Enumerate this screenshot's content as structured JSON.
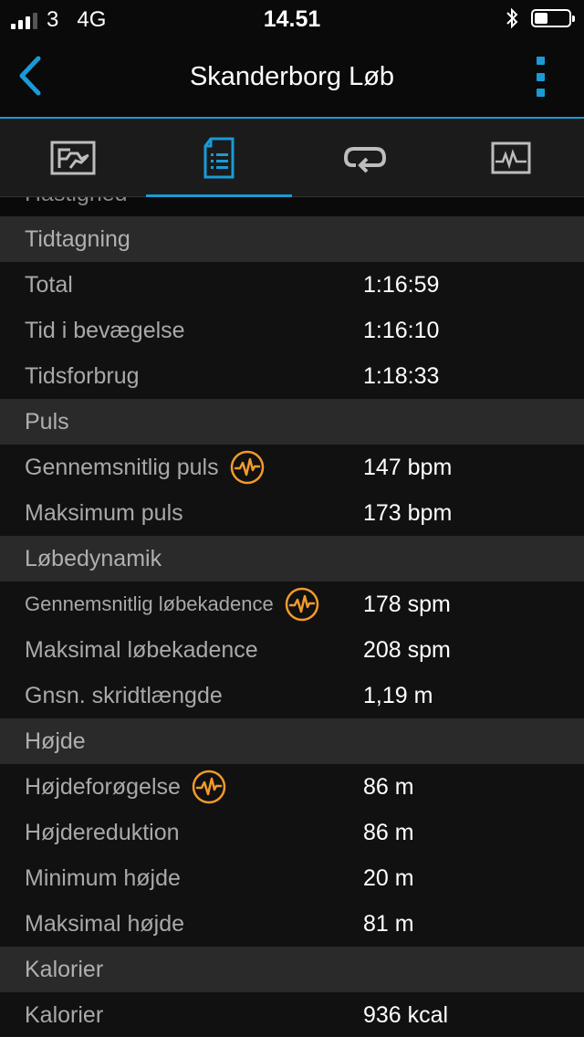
{
  "status_bar": {
    "carrier": "3",
    "network": "4G",
    "time": "14.51",
    "signal_bars": 3,
    "battery_fraction": 0.4
  },
  "nav": {
    "title": "Skanderborg Løb",
    "back_icon": "chevron-left-icon",
    "more_icon": "vertical-dots-icon"
  },
  "tabs": [
    {
      "icon": "map-icon",
      "active": false
    },
    {
      "icon": "document-list-icon",
      "active": true
    },
    {
      "icon": "laps-icon",
      "active": false
    },
    {
      "icon": "chart-icon",
      "active": false
    }
  ],
  "content": {
    "cutoff_label": "Hastighed",
    "sections": [
      {
        "title": "Tidtagning",
        "rows": [
          {
            "label": "Total",
            "value": "1:16:59"
          },
          {
            "label": "Tid i bevægelse",
            "value": "1:16:10"
          },
          {
            "label": "Tidsforbrug",
            "value": "1:18:33"
          }
        ]
      },
      {
        "title": "Puls",
        "rows": [
          {
            "label": "Gennemsnitlig puls",
            "value": "147 bpm",
            "icon": "heart-rate-icon"
          },
          {
            "label": "Maksimum puls",
            "value": "173 bpm"
          }
        ]
      },
      {
        "title": "Løbedynamik",
        "rows": [
          {
            "label": "Gennemsnitlig løbekadence",
            "value": "178 spm",
            "icon": "heart-rate-icon"
          },
          {
            "label": "Maksimal løbekadence",
            "value": "208 spm"
          },
          {
            "label": "Gnsn. skridtlængde",
            "value": "1,19 m"
          }
        ]
      },
      {
        "title": "Højde",
        "rows": [
          {
            "label": "Højdeforøgelse",
            "value": "86 m",
            "icon": "heart-rate-icon"
          },
          {
            "label": "Højdereduktion",
            "value": "86 m"
          },
          {
            "label": "Minimum højde",
            "value": "20 m"
          },
          {
            "label": "Maksimal højde",
            "value": "81 m"
          }
        ]
      },
      {
        "title": "Kalorier",
        "rows": [
          {
            "label": "Kalorier",
            "value": "936 kcal"
          }
        ]
      }
    ]
  },
  "colors": {
    "accent": "#1a9ad6",
    "icon_orange": "#f39a2b",
    "header_bg": "#2a2a2a",
    "row_bg": "#111111"
  }
}
